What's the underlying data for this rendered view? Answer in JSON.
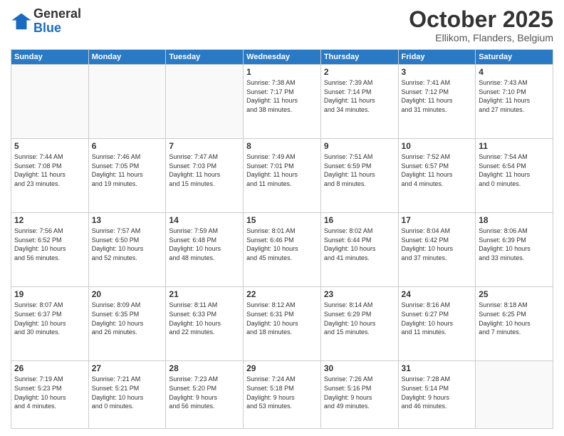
{
  "header": {
    "logo_general": "General",
    "logo_blue": "Blue",
    "month": "October 2025",
    "location": "Ellikom, Flanders, Belgium"
  },
  "days_of_week": [
    "Sunday",
    "Monday",
    "Tuesday",
    "Wednesday",
    "Thursday",
    "Friday",
    "Saturday"
  ],
  "weeks": [
    [
      {
        "day": "",
        "info": ""
      },
      {
        "day": "",
        "info": ""
      },
      {
        "day": "",
        "info": ""
      },
      {
        "day": "1",
        "info": "Sunrise: 7:38 AM\nSunset: 7:17 PM\nDaylight: 11 hours\nand 38 minutes."
      },
      {
        "day": "2",
        "info": "Sunrise: 7:39 AM\nSunset: 7:14 PM\nDaylight: 11 hours\nand 34 minutes."
      },
      {
        "day": "3",
        "info": "Sunrise: 7:41 AM\nSunset: 7:12 PM\nDaylight: 11 hours\nand 31 minutes."
      },
      {
        "day": "4",
        "info": "Sunrise: 7:43 AM\nSunset: 7:10 PM\nDaylight: 11 hours\nand 27 minutes."
      }
    ],
    [
      {
        "day": "5",
        "info": "Sunrise: 7:44 AM\nSunset: 7:08 PM\nDaylight: 11 hours\nand 23 minutes."
      },
      {
        "day": "6",
        "info": "Sunrise: 7:46 AM\nSunset: 7:05 PM\nDaylight: 11 hours\nand 19 minutes."
      },
      {
        "day": "7",
        "info": "Sunrise: 7:47 AM\nSunset: 7:03 PM\nDaylight: 11 hours\nand 15 minutes."
      },
      {
        "day": "8",
        "info": "Sunrise: 7:49 AM\nSunset: 7:01 PM\nDaylight: 11 hours\nand 11 minutes."
      },
      {
        "day": "9",
        "info": "Sunrise: 7:51 AM\nSunset: 6:59 PM\nDaylight: 11 hours\nand 8 minutes."
      },
      {
        "day": "10",
        "info": "Sunrise: 7:52 AM\nSunset: 6:57 PM\nDaylight: 11 hours\nand 4 minutes."
      },
      {
        "day": "11",
        "info": "Sunrise: 7:54 AM\nSunset: 6:54 PM\nDaylight: 11 hours\nand 0 minutes."
      }
    ],
    [
      {
        "day": "12",
        "info": "Sunrise: 7:56 AM\nSunset: 6:52 PM\nDaylight: 10 hours\nand 56 minutes."
      },
      {
        "day": "13",
        "info": "Sunrise: 7:57 AM\nSunset: 6:50 PM\nDaylight: 10 hours\nand 52 minutes."
      },
      {
        "day": "14",
        "info": "Sunrise: 7:59 AM\nSunset: 6:48 PM\nDaylight: 10 hours\nand 48 minutes."
      },
      {
        "day": "15",
        "info": "Sunrise: 8:01 AM\nSunset: 6:46 PM\nDaylight: 10 hours\nand 45 minutes."
      },
      {
        "day": "16",
        "info": "Sunrise: 8:02 AM\nSunset: 6:44 PM\nDaylight: 10 hours\nand 41 minutes."
      },
      {
        "day": "17",
        "info": "Sunrise: 8:04 AM\nSunset: 6:42 PM\nDaylight: 10 hours\nand 37 minutes."
      },
      {
        "day": "18",
        "info": "Sunrise: 8:06 AM\nSunset: 6:39 PM\nDaylight: 10 hours\nand 33 minutes."
      }
    ],
    [
      {
        "day": "19",
        "info": "Sunrise: 8:07 AM\nSunset: 6:37 PM\nDaylight: 10 hours\nand 30 minutes."
      },
      {
        "day": "20",
        "info": "Sunrise: 8:09 AM\nSunset: 6:35 PM\nDaylight: 10 hours\nand 26 minutes."
      },
      {
        "day": "21",
        "info": "Sunrise: 8:11 AM\nSunset: 6:33 PM\nDaylight: 10 hours\nand 22 minutes."
      },
      {
        "day": "22",
        "info": "Sunrise: 8:12 AM\nSunset: 6:31 PM\nDaylight: 10 hours\nand 18 minutes."
      },
      {
        "day": "23",
        "info": "Sunrise: 8:14 AM\nSunset: 6:29 PM\nDaylight: 10 hours\nand 15 minutes."
      },
      {
        "day": "24",
        "info": "Sunrise: 8:16 AM\nSunset: 6:27 PM\nDaylight: 10 hours\nand 11 minutes."
      },
      {
        "day": "25",
        "info": "Sunrise: 8:18 AM\nSunset: 6:25 PM\nDaylight: 10 hours\nand 7 minutes."
      }
    ],
    [
      {
        "day": "26",
        "info": "Sunrise: 7:19 AM\nSunset: 5:23 PM\nDaylight: 10 hours\nand 4 minutes."
      },
      {
        "day": "27",
        "info": "Sunrise: 7:21 AM\nSunset: 5:21 PM\nDaylight: 10 hours\nand 0 minutes."
      },
      {
        "day": "28",
        "info": "Sunrise: 7:23 AM\nSunset: 5:20 PM\nDaylight: 9 hours\nand 56 minutes."
      },
      {
        "day": "29",
        "info": "Sunrise: 7:24 AM\nSunset: 5:18 PM\nDaylight: 9 hours\nand 53 minutes."
      },
      {
        "day": "30",
        "info": "Sunrise: 7:26 AM\nSunset: 5:16 PM\nDaylight: 9 hours\nand 49 minutes."
      },
      {
        "day": "31",
        "info": "Sunrise: 7:28 AM\nSunset: 5:14 PM\nDaylight: 9 hours\nand 46 minutes."
      },
      {
        "day": "",
        "info": ""
      }
    ]
  ]
}
